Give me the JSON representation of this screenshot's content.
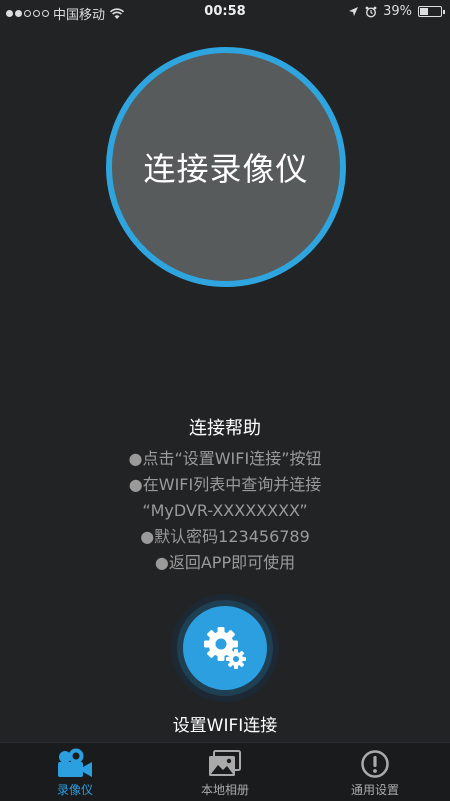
{
  "status_bar": {
    "signal_full": 2,
    "signal_empty": 3,
    "carrier": "中国移动",
    "time": "00:58",
    "battery": "39%",
    "battery_level": 0.39
  },
  "main": {
    "connect_button_label": "连接录像仪"
  },
  "help": {
    "title": "连接帮助",
    "lines": [
      "●点击“设置WIFI连接”按钮",
      "●在WIFI列表中查询并连接",
      "“MyDVR-XXXXXXXX”",
      "●默认密码123456789",
      "●返回APP即可使用"
    ]
  },
  "wifi_setup": {
    "label": "设置WIFI连接",
    "icon": "gear-icon"
  },
  "tabs": [
    {
      "label": "录像仪",
      "icon": "video-camera-icon",
      "active": true
    },
    {
      "label": "本地相册",
      "icon": "photo-album-icon",
      "active": false
    },
    {
      "label": "通用设置",
      "icon": "exclamation-circle-icon",
      "active": false
    }
  ],
  "colors": {
    "accent": "#2b9fe0",
    "background": "#222325",
    "circle_fill": "#585b5c"
  }
}
